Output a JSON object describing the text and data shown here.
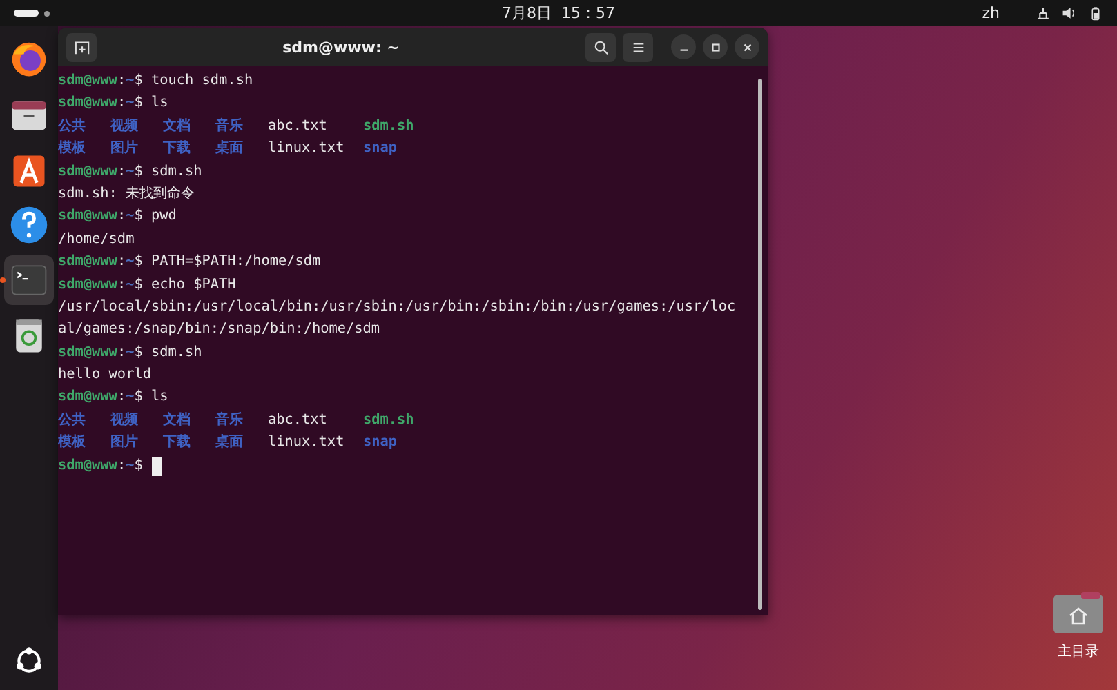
{
  "top_bar": {
    "clock": "7月8日  15：57",
    "input_method": "zh"
  },
  "dock": {
    "items": [
      {
        "kind": "browser",
        "active": false
      },
      {
        "kind": "files",
        "active": false
      },
      {
        "kind": "store",
        "active": false
      },
      {
        "kind": "help",
        "active": false
      },
      {
        "kind": "terminal",
        "active": true
      },
      {
        "kind": "trash",
        "active": false
      }
    ]
  },
  "terminal": {
    "title": "sdm@www: ~",
    "lines": [
      {
        "kind": "prompt",
        "user": "sdm@www",
        "sep": ":",
        "path": "~",
        "sign": "$",
        "command": "touch sdm.sh"
      },
      {
        "kind": "prompt",
        "user": "sdm@www",
        "sep": ":",
        "path": "~",
        "sign": "$",
        "command": "ls"
      },
      {
        "kind": "listing",
        "entries": [
          {
            "name": "公共",
            "kind": "dir"
          },
          {
            "name": "视频",
            "kind": "dir"
          },
          {
            "name": "文档",
            "kind": "dir"
          },
          {
            "name": "音乐",
            "kind": "dir"
          },
          {
            "name": "abc.txt",
            "kind": "file"
          },
          {
            "name": "sdm.sh",
            "kind": "exec"
          }
        ]
      },
      {
        "kind": "listing",
        "entries": [
          {
            "name": "模板",
            "kind": "dir"
          },
          {
            "name": "图片",
            "kind": "dir"
          },
          {
            "name": "下载",
            "kind": "dir"
          },
          {
            "name": "桌面",
            "kind": "dir"
          },
          {
            "name": "linux.txt",
            "kind": "file"
          },
          {
            "name": "snap",
            "kind": "dir"
          }
        ]
      },
      {
        "kind": "prompt",
        "user": "sdm@www",
        "sep": ":",
        "path": "~",
        "sign": "$",
        "command": "sdm.sh"
      },
      {
        "kind": "output",
        "text": "sdm.sh: 未找到命令"
      },
      {
        "kind": "prompt",
        "user": "sdm@www",
        "sep": ":",
        "path": "~",
        "sign": "$",
        "command": "pwd"
      },
      {
        "kind": "output",
        "text": "/home/sdm"
      },
      {
        "kind": "prompt",
        "user": "sdm@www",
        "sep": ":",
        "path": "~",
        "sign": "$",
        "command": "PATH=$PATH:/home/sdm"
      },
      {
        "kind": "prompt",
        "user": "sdm@www",
        "sep": ":",
        "path": "~",
        "sign": "$",
        "command": "echo $PATH"
      },
      {
        "kind": "output",
        "text": "/usr/local/sbin:/usr/local/bin:/usr/sbin:/usr/bin:/sbin:/bin:/usr/games:/usr/loc"
      },
      {
        "kind": "output",
        "text": "al/games:/snap/bin:/snap/bin:/home/sdm"
      },
      {
        "kind": "prompt",
        "user": "sdm@www",
        "sep": ":",
        "path": "~",
        "sign": "$",
        "command": "sdm.sh"
      },
      {
        "kind": "output",
        "text": "hello world"
      },
      {
        "kind": "prompt",
        "user": "sdm@www",
        "sep": ":",
        "path": "~",
        "sign": "$",
        "command": "ls"
      },
      {
        "kind": "listing",
        "entries": [
          {
            "name": "公共",
            "kind": "dir"
          },
          {
            "name": "视频",
            "kind": "dir"
          },
          {
            "name": "文档",
            "kind": "dir"
          },
          {
            "name": "音乐",
            "kind": "dir"
          },
          {
            "name": "abc.txt",
            "kind": "file"
          },
          {
            "name": "sdm.sh",
            "kind": "exec"
          }
        ]
      },
      {
        "kind": "listing",
        "entries": [
          {
            "name": "模板",
            "kind": "dir"
          },
          {
            "name": "图片",
            "kind": "dir"
          },
          {
            "name": "下载",
            "kind": "dir"
          },
          {
            "name": "桌面",
            "kind": "dir"
          },
          {
            "name": "linux.txt",
            "kind": "file"
          },
          {
            "name": "snap",
            "kind": "dir"
          }
        ]
      },
      {
        "kind": "prompt",
        "user": "sdm@www",
        "sep": ":",
        "path": "~",
        "sign": "$",
        "cursor": true
      }
    ]
  },
  "desktop_icons": [
    {
      "label": "主目录"
    }
  ]
}
